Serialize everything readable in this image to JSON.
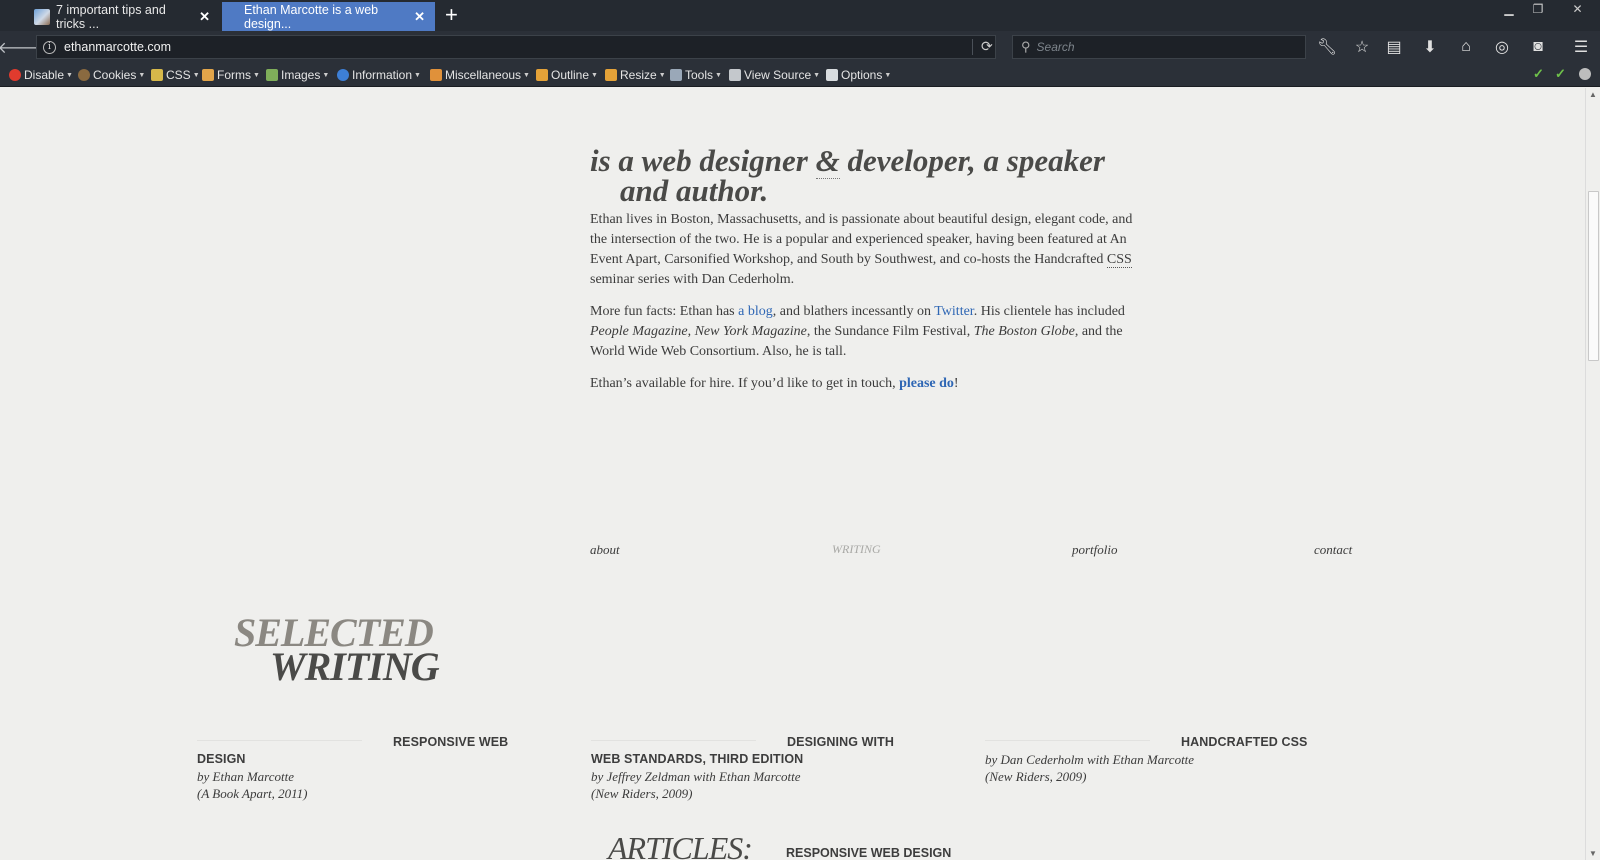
{
  "tabs": [
    {
      "title": "7 important tips and tricks ...",
      "active": false
    },
    {
      "title": "Ethan Marcotte is a web design...",
      "active": true
    }
  ],
  "navbar": {
    "url": "ethanmarcotte.com",
    "search_placeholder": "Search"
  },
  "toolbar_icons": [
    "wrench-icon",
    "star-icon",
    "reading-list-icon",
    "download-icon",
    "home-icon",
    "globe-icon",
    "pocket-icon",
    "hamburger-menu-icon"
  ],
  "devtoolbar": {
    "items": [
      "Disable",
      "Cookies",
      "CSS",
      "Forms",
      "Images",
      "Information",
      "Miscellaneous",
      "Outline",
      "Resize",
      "Tools",
      "View Source",
      "Options"
    ]
  },
  "colors": {
    "page_bg": "#efefed",
    "link": "#2e66b4",
    "chrome_bg": "#2b3038",
    "active_tab": "#4f7ac4"
  },
  "content": {
    "headline_part1": "is a web designer ",
    "headline_amp": "&",
    "headline_part2": " developer, a speaker",
    "headline_line2": "and author.",
    "p1_a": "Ethan lives in Boston, Massachusetts, and is passionate about beautiful design, elegant code, and the intersection of the two. He is a popular and experienced speaker, having been featured at An Event Apart, Carsonified Workshop, and South by Southwest, and co-hosts the Handcrafted ",
    "p1_abbr": "CSS",
    "p1_b": " seminar series with Dan Cederholm.",
    "p2_a": "More fun facts: Ethan has ",
    "p2_link_blog": "a blog",
    "p2_b": ", and blathers incessantly on ",
    "p2_link_twitter": "Twitter",
    "p2_c": ". His clientele has included ",
    "p2_em1": "People Magazine",
    "p2_d": ", ",
    "p2_em2": "New York Magazine",
    "p2_e": ", the Sundance Film Festival, ",
    "p2_em3": "The Boston Globe",
    "p2_f": ", and the World Wide Web Consortium. Also, he is tall.",
    "p3_a": "Ethan’s available for hire. If you’d like to get in touch, ",
    "p3_link": "please do",
    "p3_b": "!"
  },
  "site_nav": {
    "about": "about",
    "writing": "WRITING",
    "portfolio": "portfolio",
    "contact": "contact"
  },
  "selected": {
    "word1": "SELECTED",
    "word2": "WRITING"
  },
  "books": [
    {
      "title": "RESPONSIVE WEB DESIGN",
      "author": "by Ethan Marcotte",
      "pub": "(A Book Apart, 2011)"
    },
    {
      "title": "DESIGNING WITH WEB STANDARDS, THIRD EDITION",
      "author": "by Jeffrey Zeldman with Ethan Marcotte",
      "pub": "(New Riders, 2009)"
    },
    {
      "title": "HANDCRAFTED CSS",
      "author": "by Dan Cederholm with Ethan Marcotte",
      "pub": "(New Riders, 2009)"
    }
  ],
  "articles": {
    "heading": "ARTICLES:",
    "first_title": "RESPONSIVE WEB DESIGN"
  }
}
